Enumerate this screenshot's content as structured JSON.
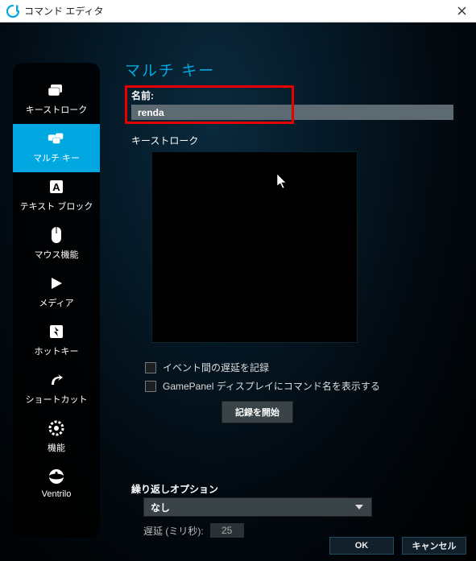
{
  "window": {
    "title": "コマンド エディタ"
  },
  "sidebar": {
    "items": [
      {
        "label": "キーストローク",
        "icon": "keystroke-icon"
      },
      {
        "label": "マルチ キー",
        "icon": "multikey-icon"
      },
      {
        "label": "テキスト ブロック",
        "icon": "textblock-icon"
      },
      {
        "label": "マウス機能",
        "icon": "mouse-icon"
      },
      {
        "label": "メディア",
        "icon": "media-icon"
      },
      {
        "label": "ホットキー",
        "icon": "hotkey-icon"
      },
      {
        "label": "ショートカット",
        "icon": "shortcut-icon"
      },
      {
        "label": "機能",
        "icon": "functions-icon"
      },
      {
        "label": "Ventrilo",
        "icon": "ventrilo-icon"
      }
    ],
    "selected_index": 1
  },
  "main": {
    "title": "マルチ キー",
    "name_label": "名前:",
    "name_value": "renda",
    "keystrokes_label": "キーストローク",
    "cb_record_delays": "イベント間の遅延を記録",
    "cb_show_on_gamepanel": "GamePanel ディスプレイにコマンド名を表示する",
    "record_button": "記録を開始",
    "repeat_label": "繰り返しオプション",
    "repeat_value": "なし",
    "delay_label": "遅延 (ミリ秒):",
    "delay_value": "25"
  },
  "buttons": {
    "ok": "OK",
    "cancel": "キャンセル"
  }
}
